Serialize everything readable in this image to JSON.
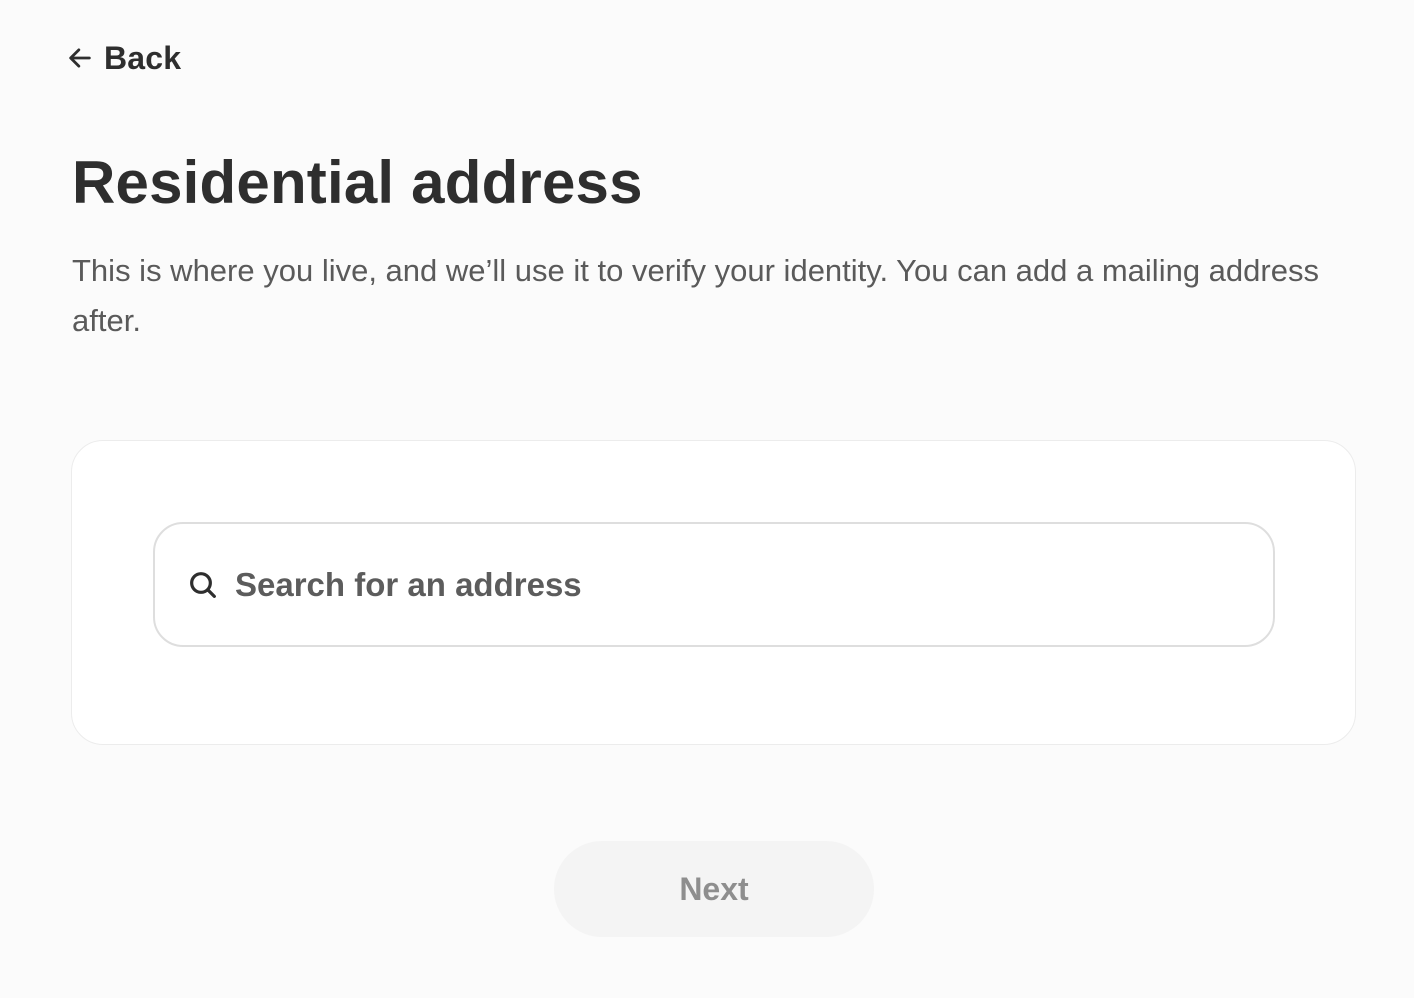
{
  "nav": {
    "back_label": "Back",
    "back_icon": "arrow-left-icon"
  },
  "header": {
    "title": "Residential address",
    "description": "This is where you live, and we’ll use it to verify your identity. You can add a mailing address after."
  },
  "address_search": {
    "icon": "search-icon",
    "value": "",
    "placeholder": "Search for an address"
  },
  "footer": {
    "next_label": "Next",
    "next_disabled": true
  },
  "colors": {
    "background": "#fbfbfb",
    "text_primary": "#2e2e2e",
    "text_secondary": "#5a5a5a",
    "card_background": "#ffffff",
    "input_border": "#dedede",
    "button_disabled_background": "#f4f4f4",
    "button_disabled_text": "#8e8e8e"
  }
}
